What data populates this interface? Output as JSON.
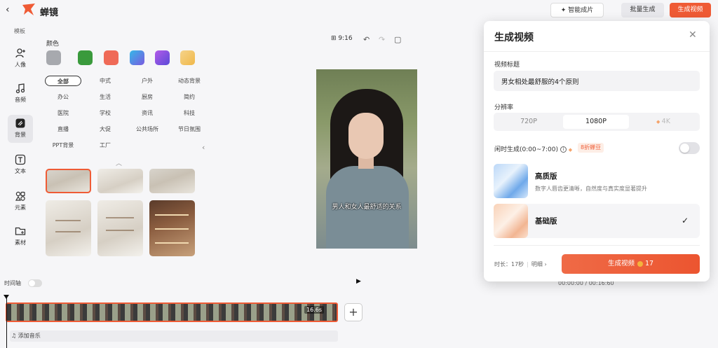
{
  "header": {
    "brand": "蝉镜",
    "smart_label": "智能成片",
    "batch_label": "批量生成",
    "generate_label": "生成视频"
  },
  "leftnav": {
    "top_label": "模板",
    "items": [
      {
        "label": "人像",
        "icon": "person-icon"
      },
      {
        "label": "音频",
        "icon": "music-icon"
      },
      {
        "label": "背景",
        "icon": "background-icon"
      },
      {
        "label": "文本",
        "icon": "text-icon"
      },
      {
        "label": "元素",
        "icon": "elements-icon"
      },
      {
        "label": "素材",
        "icon": "folder-icon"
      }
    ]
  },
  "panel": {
    "color_title": "颜色",
    "colors": [
      "#a7a9ae",
      "#3a9a3c",
      "#ef6a57",
      "#5a79d8",
      "#8a5ad8",
      "#f2c86a"
    ],
    "categories": [
      "全部",
      "中式",
      "户外",
      "动态背景",
      "办公",
      "生活",
      "厨房",
      "简约",
      "医院",
      "学校",
      "资讯",
      "科技",
      "直播",
      "大促",
      "公共场所",
      "节日氛围",
      "PPT背景",
      "工厂"
    ]
  },
  "canvas": {
    "ratio": "9:16",
    "subtitle": "男人和女人最舒适的关系"
  },
  "timeline": {
    "label": "时间轴",
    "time": "00:00:00 / 00:16:60",
    "clip_duration": "16.6s",
    "music_label": "♫ 添加音乐"
  },
  "modal": {
    "title": "生成视频",
    "title_label": "视频标题",
    "title_value": "男女相处最舒服的4个原则",
    "resolution_label": "分辨率",
    "resolutions": [
      "720P",
      "1080P",
      "4K"
    ],
    "resolution_selected": "1080P",
    "idle_label": "闲时生成(0:00~7:00)",
    "discount": "8折蝉豆",
    "quality_options": [
      {
        "name": "高质版",
        "desc": "数字人唇齿更清晰，自然度与真实度显著提升"
      },
      {
        "name": "基础版",
        "desc": ""
      }
    ],
    "quality_selected": "基础版",
    "duration_label": "时长：17秒",
    "detail_label": "明细",
    "generate_label": "生成视频",
    "cost": "17"
  }
}
